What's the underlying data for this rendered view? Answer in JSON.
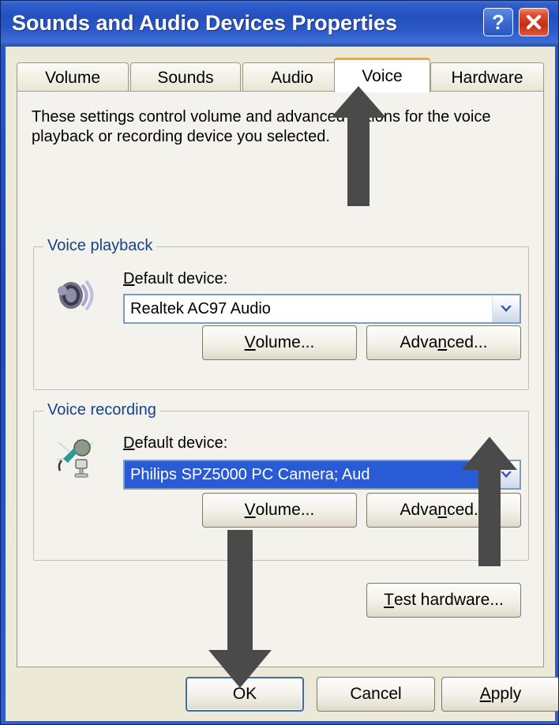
{
  "window": {
    "title": "Sounds and Audio Devices Properties",
    "help_button_label": "?",
    "close_button_label": "close-icon",
    "titlebar_color": "#2450bf"
  },
  "tabs": [
    {
      "label": "Volume",
      "selected": false
    },
    {
      "label": "Sounds",
      "selected": false
    },
    {
      "label": "Audio",
      "selected": false
    },
    {
      "label": "Voice",
      "selected": true
    },
    {
      "label": "Hardware",
      "selected": false
    }
  ],
  "tab_selected_accent_color": "#f0a830",
  "page": {
    "description": "These settings control volume and advanced options for the voice playback or recording device you selected.",
    "playback": {
      "group_title": "Voice playback",
      "icon": "speaker-icon",
      "device_label_prefix": "D",
      "device_label_rest": "efault device:",
      "device_value": "Realtek AC97 Audio",
      "selected": false,
      "buttons": [
        {
          "prefix": "",
          "accel": "V",
          "rest": "olume..."
        },
        {
          "prefix": "Adva",
          "accel": "n",
          "rest": "ced..."
        }
      ]
    },
    "recording": {
      "group_title": "Voice recording",
      "icon": "microphone-icon",
      "device_label_prefix": "D",
      "device_label_rest": "efault device:",
      "device_value": "Philips  SPZ5000   PC Camera; Aud",
      "selected": true,
      "selection_color": "#2a5bd7",
      "buttons": [
        {
          "prefix": "",
          "accel": "V",
          "rest": "olume..."
        },
        {
          "prefix": "Adva",
          "accel": "n",
          "rest": "ced..."
        }
      ]
    },
    "test_hardware": {
      "prefix": "",
      "accel": "T",
      "rest": "est hardware..."
    }
  },
  "dialog_buttons": [
    {
      "prefix": "",
      "accel": "",
      "rest": "OK",
      "default": true
    },
    {
      "prefix": "",
      "accel": "",
      "rest": "Cancel",
      "default": false
    },
    {
      "prefix": "",
      "accel": "A",
      "rest": "pply",
      "default": false
    }
  ],
  "annotations": {
    "arrow_color": "#4a4a4a",
    "arrows": [
      {
        "name": "arrow-pointing-to-voice-tab",
        "direction": "up"
      },
      {
        "name": "arrow-pointing-to-recording-dropdown",
        "direction": "up"
      },
      {
        "name": "arrow-pointing-to-ok-button",
        "direction": "down"
      }
    ]
  }
}
